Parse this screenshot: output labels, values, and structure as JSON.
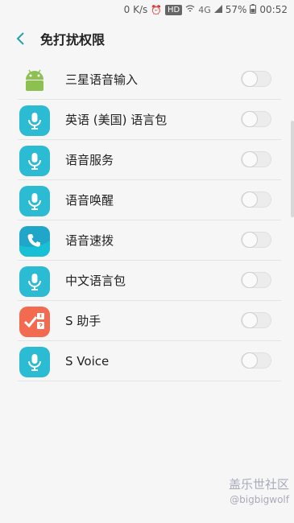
{
  "status": {
    "speed": "0 K/s",
    "hd": "HD",
    "network": "4G",
    "battery": "57%",
    "time": "00:52"
  },
  "header": {
    "title": "免打扰权限"
  },
  "apps": [
    {
      "label": "三星语音输入",
      "icon": "android-icon",
      "enabled": false
    },
    {
      "label": "英语 (美国) 语言包",
      "icon": "microphone-icon",
      "enabled": false
    },
    {
      "label": "语音服务",
      "icon": "microphone-icon",
      "enabled": false
    },
    {
      "label": "语音唤醒",
      "icon": "microphone-icon",
      "enabled": false
    },
    {
      "label": "语音速拨",
      "icon": "phone-icon",
      "enabled": false
    },
    {
      "label": "中文语言包",
      "icon": "microphone-icon",
      "enabled": false
    },
    {
      "label": "S 助手",
      "icon": "checklist-icon",
      "enabled": false
    },
    {
      "label": "S Voice",
      "icon": "microphone-icon",
      "enabled": false
    }
  ],
  "watermark": {
    "site": "盖乐世社区",
    "handle": "@bigbigwolf"
  },
  "colors": {
    "accent": "#2a9fb0",
    "mic": "#2bbcd4",
    "android": "#8cc152",
    "assistant": "#f26a4f"
  }
}
